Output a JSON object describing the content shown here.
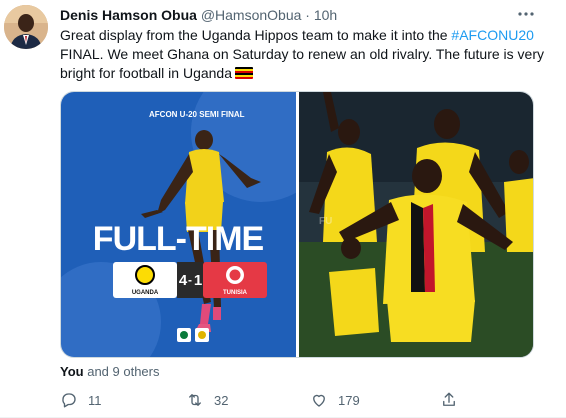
{
  "tweet": {
    "author_name": "Denis Hamson Obua",
    "author_handle": "@HamsonObua",
    "separator": "·",
    "timestamp": "10h",
    "text_part1": "Great display from the Uganda Hippos team to make it into the ",
    "hashtag": "#AFCONU20",
    "text_part2": " FINAL. We meet Ghana on Saturday to renew an old rivalry. The future is very bright for football in Uganda",
    "flag_icon": "uganda-flag-emoji"
  },
  "media": {
    "left": {
      "banner": "AFCON U-20 SEMI FINAL",
      "headline": "FULL-TIME",
      "home_team": "UGANDA",
      "home_score": "4",
      "score_sep": "-",
      "away_score": "1",
      "away_team": "TUNISIA",
      "bg_color": "#1f5fb8"
    },
    "right": {
      "description_colors": {
        "kit": "#f4d81a",
        "pitch": "#2b4c25"
      }
    }
  },
  "engagement": {
    "likes_prefix": "You",
    "likes_suffix": "and 9 others"
  },
  "actions": {
    "reply_count": "11",
    "retweet_count": "32",
    "like_count": "179"
  },
  "colors": {
    "accent": "#1d9bf0",
    "muted": "#536471"
  }
}
